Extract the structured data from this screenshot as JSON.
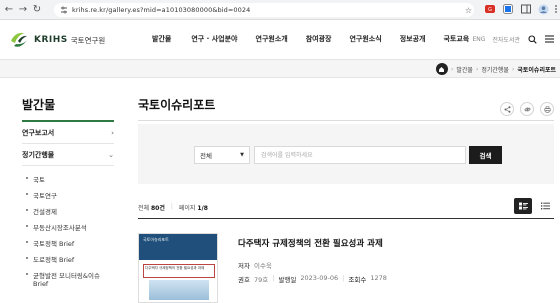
{
  "browser": {
    "url": "krihs.re.kr/gallery.es?mid=a10103080000&bid=0024"
  },
  "header": {
    "logo_text": "KRIHS",
    "logo_sub": "국토연구원",
    "nav": [
      "발간물",
      "연구 · 사업분야",
      "연구원소개",
      "참여광장",
      "연구원소식",
      "정보공개",
      "국토교육"
    ],
    "links": [
      "ENG",
      "전자도서관"
    ]
  },
  "breadcrumb": [
    "발간물",
    "정기간행물",
    "국토이슈리포트"
  ],
  "sidebar": {
    "title": "발간물",
    "sections": [
      {
        "label": "연구보고서",
        "arrow": "›"
      },
      {
        "label": "정기간행물",
        "arrow": "⌄"
      }
    ],
    "sub_items": [
      {
        "label": "국토",
        "active": false
      },
      {
        "label": "국토연구",
        "active": false
      },
      {
        "label": "건설경제",
        "active": false
      },
      {
        "label": "부동산시장조사분석",
        "active": false
      },
      {
        "label": "국토정책 Brief",
        "active": false
      },
      {
        "label": "도로정책 Brief",
        "active": false
      },
      {
        "label": "균형발전 모니터링&이슈 Brief",
        "active": false
      }
    ]
  },
  "main": {
    "title": "국토이슈리포트",
    "search": {
      "select_value": "전체",
      "placeholder": "검색어를 입력하세요",
      "button": "검색"
    },
    "count": {
      "total_label": "전체",
      "total_value": "80건",
      "page_label": "페이지",
      "page_value": "1/8"
    },
    "items": [
      {
        "thumb_label": "국토이슈리포트",
        "thumb_title": "다주택자 규제정책의 전환 필요성과 과제",
        "title": "다주택자 규제정책의 전환 필요성과 과제",
        "author_label": "저자",
        "author": "이수욱",
        "issue_label": "권호",
        "issue": "79호",
        "date_label": "발행일",
        "date": "2023-09-06",
        "views_label": "조회수",
        "views": "1278"
      }
    ]
  },
  "colors": {
    "accent": "#2f7a40",
    "dark_button": "#1c1c1c"
  }
}
